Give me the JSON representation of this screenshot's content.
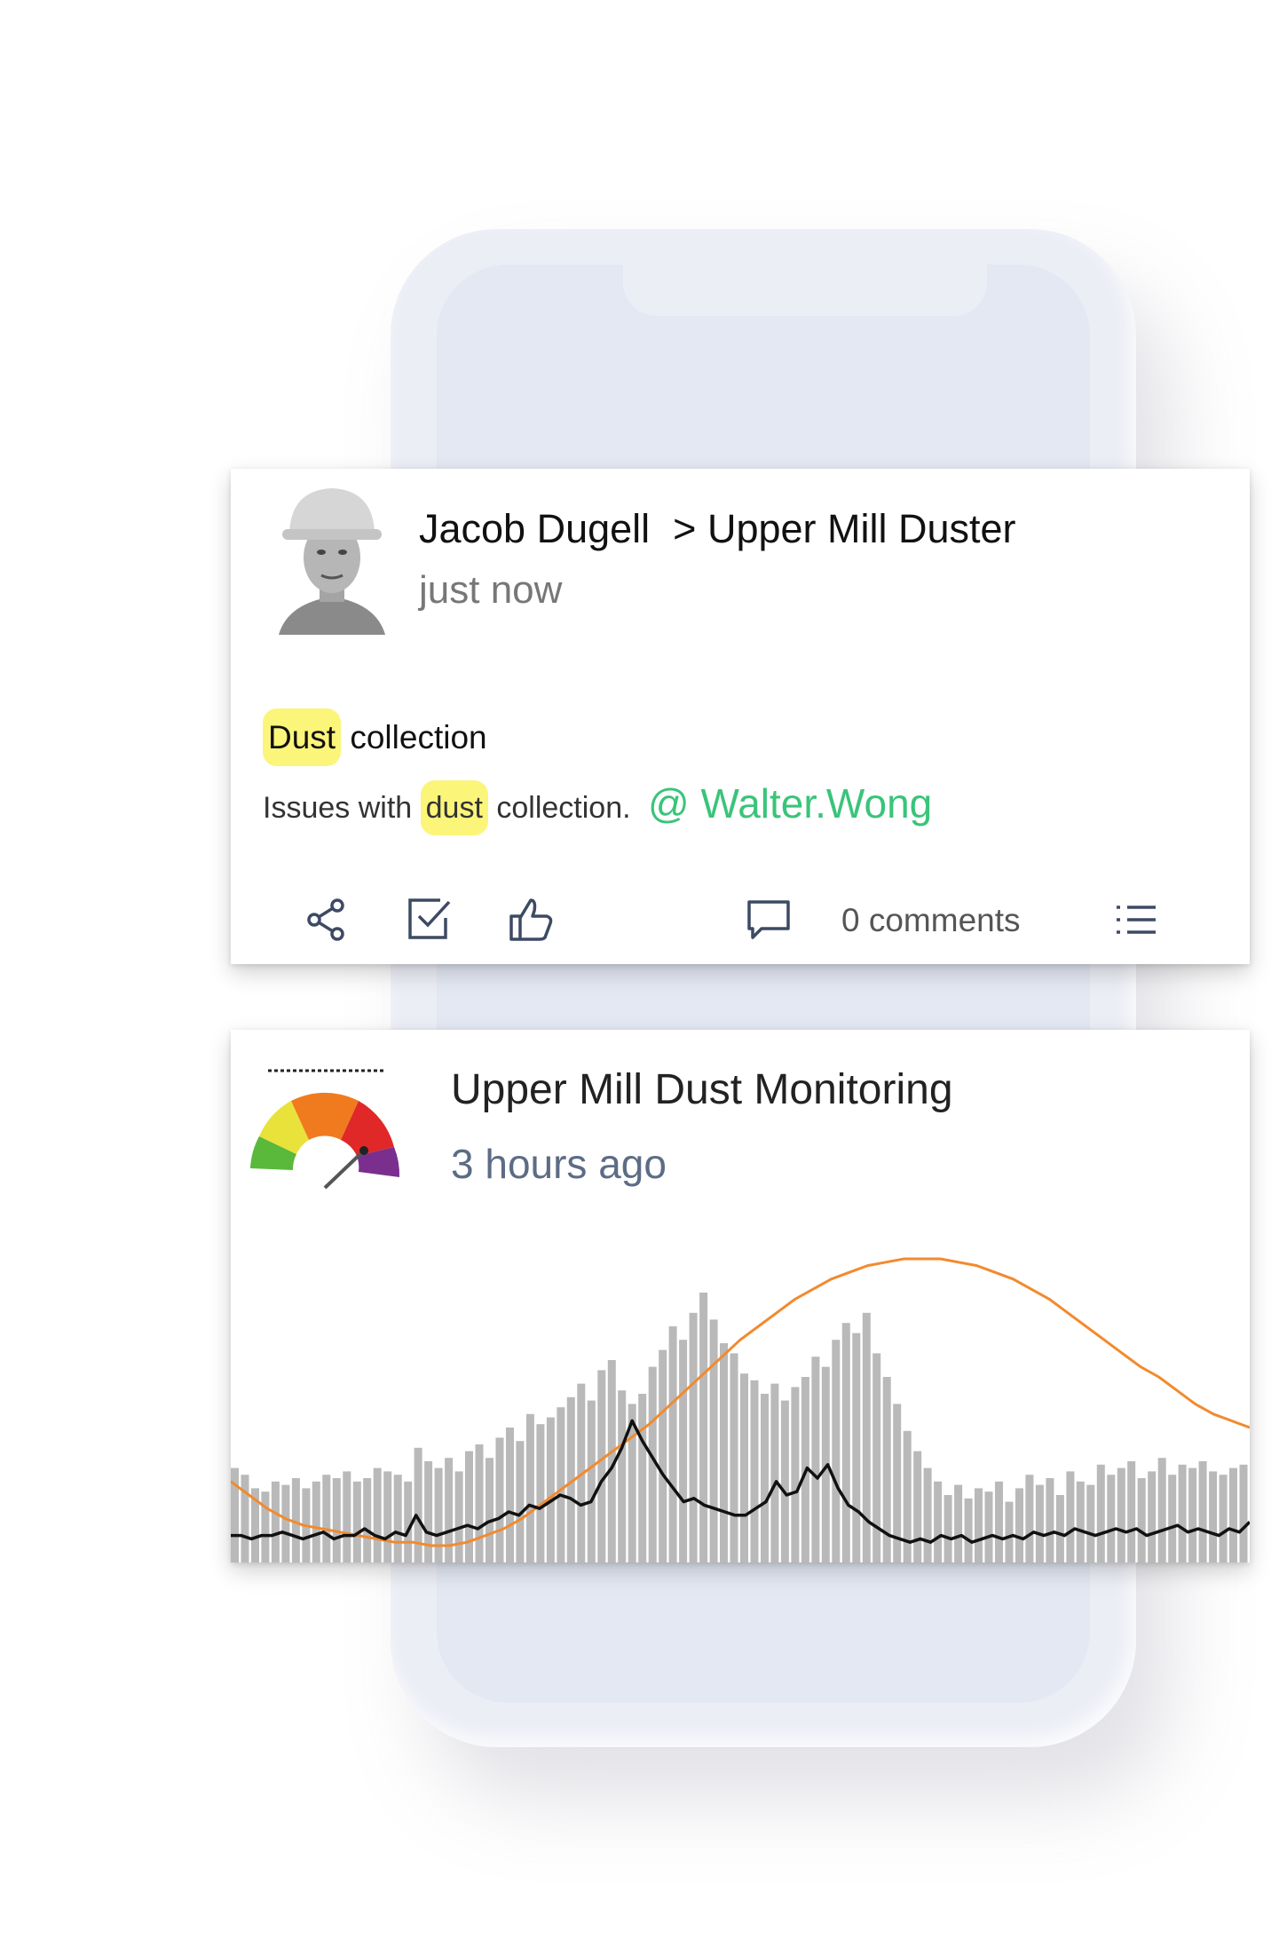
{
  "post": {
    "author": "Jacob Dugell",
    "separator": ">",
    "destination": "Upper Mill Duster",
    "time": "just now",
    "title_highlight": "Dust",
    "title_rest": "collection",
    "body_prefix": "Issues with",
    "body_highlight": "dust",
    "body_suffix": "collection.",
    "mention": "@ Walter.Wong",
    "comments": "0 comments"
  },
  "monitor": {
    "title": "Upper Mill Dust Monitoring",
    "time": "3 hours ago"
  },
  "colors": {
    "highlight": "#fbf57a",
    "mention": "#3ac47a",
    "bars": "#b9b9b9",
    "black_line": "#111111",
    "orange_line": "#f28a2e"
  },
  "chart_data": {
    "type": "bar",
    "series": [
      {
        "values": [
          28,
          26,
          22,
          21,
          24,
          23,
          25,
          22,
          24,
          26,
          25,
          27,
          24,
          25,
          28,
          27,
          26,
          24,
          34,
          30,
          28,
          31,
          27,
          33,
          35,
          31,
          37,
          40,
          36,
          44,
          41,
          43,
          46,
          49,
          53,
          48,
          57,
          60,
          51,
          47,
          50,
          58,
          63,
          70,
          66,
          74,
          80,
          72,
          65,
          62,
          56,
          54,
          50,
          53,
          48,
          52,
          55,
          61,
          58,
          66,
          71,
          68,
          74,
          62,
          55,
          47,
          39,
          33,
          28,
          24,
          20,
          23,
          19,
          22,
          21,
          24,
          18,
          22,
          26,
          23,
          25,
          20,
          27,
          24,
          23,
          29,
          26,
          28,
          30,
          25,
          27,
          31,
          26,
          29,
          28,
          30,
          27,
          26,
          28,
          29
        ]
      },
      {
        "values": [
          8,
          8,
          7,
          8,
          8,
          9,
          8,
          7,
          8,
          9,
          7,
          8,
          8,
          10,
          8,
          7,
          9,
          8,
          14,
          9,
          8,
          9,
          10,
          11,
          10,
          12,
          13,
          15,
          14,
          17,
          16,
          18,
          20,
          19,
          17,
          18,
          24,
          28,
          34,
          42,
          36,
          31,
          26,
          22,
          18,
          19,
          17,
          16,
          15,
          14,
          14,
          16,
          18,
          24,
          20,
          21,
          28,
          25,
          29,
          22,
          17,
          15,
          12,
          10,
          8,
          7,
          6,
          7,
          6,
          8,
          7,
          8,
          6,
          7,
          8,
          7,
          8,
          7,
          9,
          8,
          9,
          8,
          10,
          9,
          8,
          9,
          10,
          9,
          10,
          8,
          9,
          10,
          11,
          9,
          10,
          9,
          8,
          10,
          9,
          12
        ]
      },
      {
        "values": [
          24,
          20,
          16,
          13,
          11,
          10,
          9,
          8,
          7,
          6,
          6,
          5,
          5,
          6,
          8,
          10,
          13,
          17,
          21,
          25,
          29,
          33,
          37,
          41,
          46,
          51,
          56,
          61,
          66,
          70,
          74,
          78,
          81,
          84,
          86,
          88,
          89,
          90,
          90,
          90,
          89,
          88,
          86,
          84,
          81,
          78,
          74,
          70,
          66,
          62,
          58,
          55,
          51,
          47,
          44,
          42,
          40
        ]
      }
    ]
  }
}
